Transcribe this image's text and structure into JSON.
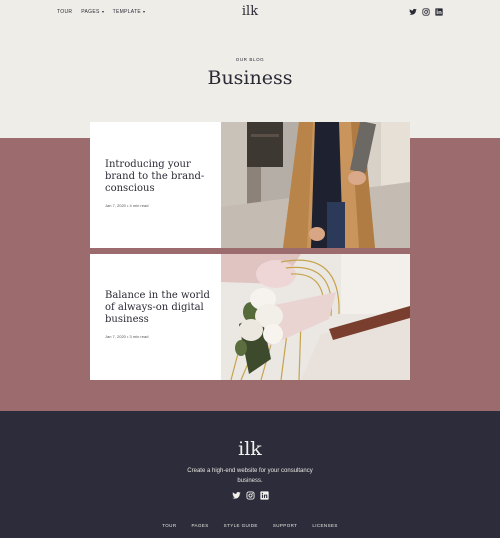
{
  "nav": {
    "items": [
      {
        "label": "TOUR",
        "has_caret": false
      },
      {
        "label": "PAGES",
        "has_caret": true
      },
      {
        "label": "TEMPLATE",
        "has_caret": true
      }
    ],
    "logo": "ilk",
    "social_icons": [
      "twitter-icon",
      "instagram-icon",
      "linkedin-icon"
    ]
  },
  "hero": {
    "subtitle": "OUR BLOG",
    "title": "Business"
  },
  "posts": [
    {
      "title": "Introducing your brand to the brand-conscious",
      "meta": "Jan 7, 2020 • 4 min read",
      "image": "woman in camel coat holding a tablet"
    },
    {
      "title": "Balance in the world of always-on digital business",
      "meta": "Jan 7, 2020 • 3 min read",
      "image": "white flowers on a rattan chair"
    }
  ],
  "footer": {
    "logo": "ilk",
    "tagline": "Create a high-end website for your consultancy business.",
    "social_icons": [
      "twitter-icon",
      "instagram-icon",
      "linkedin-icon"
    ],
    "links": [
      "TOUR",
      "PAGES",
      "STYLE GUIDE",
      "SUPPORT",
      "LICENSES"
    ]
  },
  "colors": {
    "background": "#efede8",
    "band": "#9b6b6d",
    "footer": "#2c2c3b",
    "text": "#2a2a35"
  }
}
